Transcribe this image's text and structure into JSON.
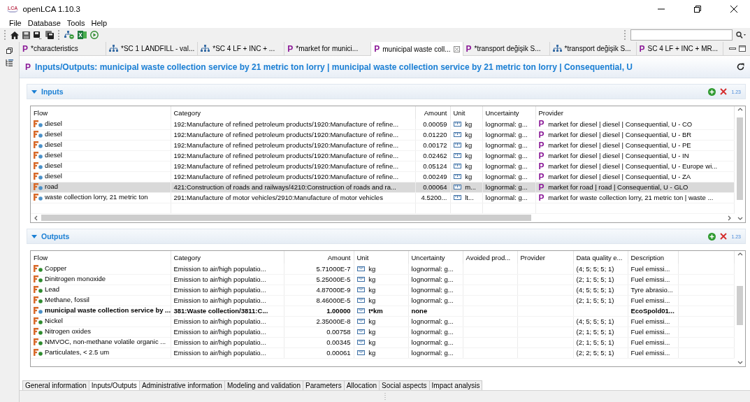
{
  "window": {
    "logo": "LCA",
    "title": "openLCA 1.10.3"
  },
  "menu": [
    "File",
    "Database",
    "Tools",
    "Help"
  ],
  "editor_tabs": [
    {
      "kind": "process",
      "symbol": "P",
      "label": "*characteristics",
      "selected": false
    },
    {
      "kind": "system",
      "label": "*SC 1 LANDFILL - val...",
      "selected": false
    },
    {
      "kind": "system",
      "label": "*SC 4 LF + INC + ...",
      "selected": false
    },
    {
      "kind": "process",
      "symbol": "P",
      "label": "*market for munici...",
      "selected": false
    },
    {
      "kind": "process",
      "symbol": "P",
      "label": "municipal waste coll...",
      "selected": true
    },
    {
      "kind": "process",
      "symbol": "P",
      "label": "*transport değişik S...",
      "selected": false
    },
    {
      "kind": "system",
      "label": "*transport değişik S...",
      "selected": false
    },
    {
      "kind": "process",
      "symbol": "P",
      "label": "SC 4 LF + INC + MR...",
      "selected": false
    }
  ],
  "header": {
    "symbol": "P",
    "title": "Inputs/Outputs: municipal waste collection service by 21 metric ton lorry | municipal waste collection service by 21 metric ton lorry | Consequential, U"
  },
  "inputs": {
    "title": "Inputs",
    "expanded": true,
    "format_label": "1.23",
    "columns": [
      "Flow",
      "Category",
      "Amount",
      "Unit",
      "Uncertainty",
      "Provider"
    ],
    "rows": [
      {
        "kind": "product",
        "flow": "diesel",
        "category": "192:Manufacture of refined petroleum products/1920:Manufacture of refine...",
        "amount": "0.00059",
        "unit": "kg",
        "uncertainty": "lognormal: g...",
        "provider_symbol": "P",
        "provider": "market for diesel | diesel | Consequential, U - CO",
        "selected": false
      },
      {
        "kind": "product",
        "flow": "diesel",
        "category": "192:Manufacture of refined petroleum products/1920:Manufacture of refine...",
        "amount": "0.01220",
        "unit": "kg",
        "uncertainty": "lognormal: g...",
        "provider_symbol": "P",
        "provider": "market for diesel | diesel | Consequential, U - BR",
        "selected": false
      },
      {
        "kind": "product",
        "flow": "diesel",
        "category": "192:Manufacture of refined petroleum products/1920:Manufacture of refine...",
        "amount": "0.00172",
        "unit": "kg",
        "uncertainty": "lognormal: g...",
        "provider_symbol": "P",
        "provider": "market for diesel | diesel | Consequential, U - PE",
        "selected": false
      },
      {
        "kind": "product",
        "flow": "diesel",
        "category": "192:Manufacture of refined petroleum products/1920:Manufacture of refine...",
        "amount": "0.02462",
        "unit": "kg",
        "uncertainty": "lognormal: g...",
        "provider_symbol": "P",
        "provider": "market for diesel | diesel | Consequential, U - IN",
        "selected": false
      },
      {
        "kind": "product",
        "flow": "diesel",
        "category": "192:Manufacture of refined petroleum products/1920:Manufacture of refine...",
        "amount": "0.05124",
        "unit": "kg",
        "uncertainty": "lognormal: g...",
        "provider_symbol": "P",
        "provider": "market for diesel | diesel | Consequential, U - Europe wi...",
        "selected": false
      },
      {
        "kind": "product",
        "flow": "diesel",
        "category": "192:Manufacture of refined petroleum products/1920:Manufacture of refine...",
        "amount": "0.00249",
        "unit": "kg",
        "uncertainty": "lognormal: g...",
        "provider_symbol": "P",
        "provider": "market for diesel | diesel | Consequential, U - ZA",
        "selected": false
      },
      {
        "kind": "product",
        "flow": "road",
        "category": "421:Construction of roads and railways/4210:Construction of roads and ra...",
        "amount": "0.00064",
        "unit": "m...",
        "uncertainty": "lognormal: g...",
        "provider_symbol": "P",
        "provider": "market for road | road | Consequential, U - GLO",
        "selected": true
      },
      {
        "kind": "product",
        "flow": "waste collection lorry, 21 metric ton",
        "category": "291:Manufacture of motor vehicles/2910:Manufacture of motor vehicles",
        "amount": "4.5200...",
        "unit": "lt...",
        "uncertainty": "lognormal: g...",
        "provider_symbol": "P",
        "provider": "market for waste collection lorry, 21 metric ton | waste ...",
        "selected": false
      }
    ]
  },
  "outputs": {
    "title": "Outputs",
    "expanded": true,
    "format_label": "1.23",
    "columns": [
      "Flow",
      "Category",
      "Amount",
      "Unit",
      "Uncertainty",
      "Avoided prod...",
      "Provider",
      "Data quality e...",
      "Description"
    ],
    "rows": [
      {
        "kind": "elementary",
        "flow": "Copper",
        "category": "Emission to air/high populatio...",
        "amount": "5.71000E-7",
        "unit": "kg",
        "uncertainty": "lognormal: g...",
        "data_quality": "(4; 5; 5; 5; 1)",
        "description": "Fuel emissi...",
        "bold": false
      },
      {
        "kind": "elementary",
        "flow": "Dinitrogen monoxide",
        "category": "Emission to air/high populatio...",
        "amount": "5.25000E-5",
        "unit": "kg",
        "uncertainty": "lognormal: g...",
        "data_quality": "(2; 1; 5; 5; 1)",
        "description": "Fuel emissi...",
        "bold": false
      },
      {
        "kind": "elementary",
        "flow": "Lead",
        "category": "Emission to air/high populatio...",
        "amount": "4.87000E-9",
        "unit": "kg",
        "uncertainty": "lognormal: g...",
        "data_quality": "(4; 5; 5; 5; 1)",
        "description": "Tyre abrasio...",
        "bold": false
      },
      {
        "kind": "elementary",
        "flow": "Methane, fossil",
        "category": "Emission to air/high populatio...",
        "amount": "8.46000E-5",
        "unit": "kg",
        "uncertainty": "lognormal: g...",
        "data_quality": "(2; 1; 5; 5; 1)",
        "description": "Fuel emissi...",
        "bold": false
      },
      {
        "kind": "product",
        "flow": "municipal waste collection service by ...",
        "category": "381:Waste collection/3811:C...",
        "amount": "1.00000",
        "unit": "t*km",
        "uncertainty": "none",
        "description": "EcoSpold01...",
        "bold": true
      },
      {
        "kind": "elementary",
        "flow": "Nickel",
        "category": "Emission to air/high populatio...",
        "amount": "2.35000E-8",
        "unit": "kg",
        "uncertainty": "lognormal: g...",
        "data_quality": "(4; 5; 5; 5; 1)",
        "description": "Fuel emissi...",
        "bold": false
      },
      {
        "kind": "elementary",
        "flow": "Nitrogen oxides",
        "category": "Emission to air/high populatio...",
        "amount": "0.00758",
        "unit": "kg",
        "uncertainty": "lognormal: g...",
        "data_quality": "(2; 1; 5; 5; 1)",
        "description": "Fuel emissi...",
        "bold": false
      },
      {
        "kind": "elementary",
        "flow": "NMVOC, non-methane volatile organic ...",
        "category": "Emission to air/high populatio...",
        "amount": "0.00345",
        "unit": "kg",
        "uncertainty": "lognormal: g...",
        "data_quality": "(2; 1; 5; 5; 1)",
        "description": "Fuel emissi...",
        "bold": false
      },
      {
        "kind": "elementary",
        "flow": "Particulates, < 2.5 um",
        "category": "Emission to air/high populatio...",
        "amount": "0.00061",
        "unit": "kg",
        "uncertainty": "lognormal: g...",
        "data_quality": "(2; 2; 5; 5; 1)",
        "description": "Fuel emissi...",
        "bold": false
      }
    ]
  },
  "bottom_tabs": [
    {
      "label": "General information",
      "selected": false
    },
    {
      "label": "Inputs/Outputs",
      "selected": true
    },
    {
      "label": "Administrative information",
      "selected": false
    },
    {
      "label": "Modeling and validation",
      "selected": false
    },
    {
      "label": "Parameters",
      "selected": false
    },
    {
      "label": "Allocation",
      "selected": false
    },
    {
      "label": "Social aspects",
      "selected": false
    },
    {
      "label": "Impact analysis",
      "selected": false
    }
  ]
}
